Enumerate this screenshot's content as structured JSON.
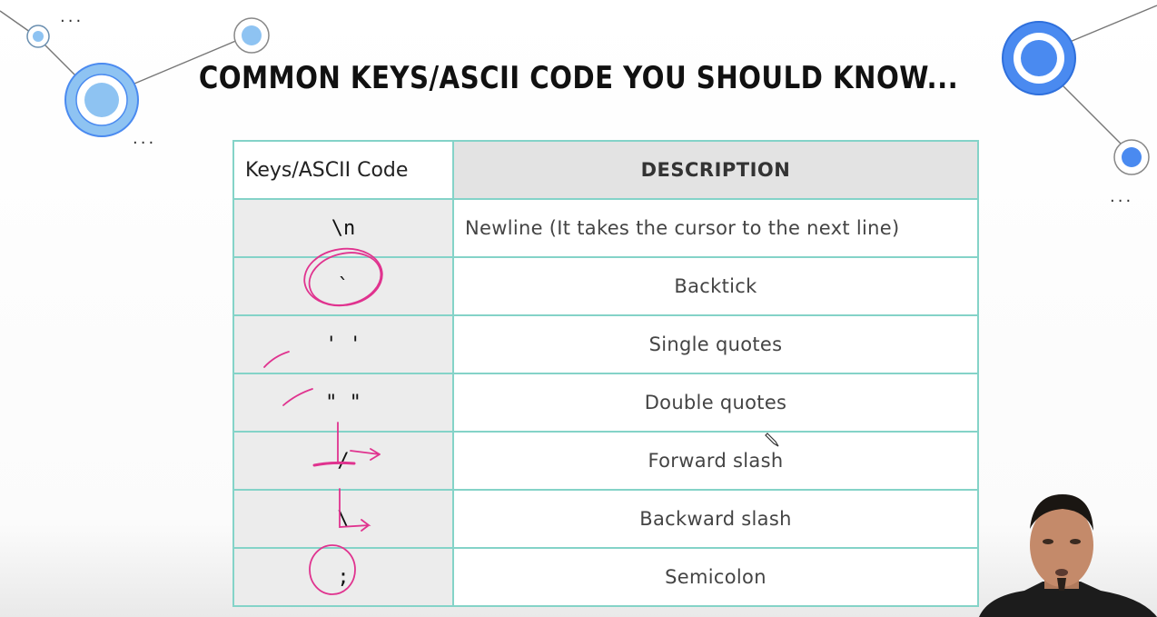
{
  "title": "COMMON KEYS/ASCII CODE YOU SHOULD KNOW...",
  "table": {
    "headers": [
      "Keys/ASCII Code",
      "DESCRIPTION"
    ],
    "rows": [
      {
        "key": "\\n",
        "description": "Newline (It takes the cursor to the next line)"
      },
      {
        "key": "`",
        "description": "Backtick"
      },
      {
        "key": "' '",
        "description": "Single quotes"
      },
      {
        "key": "\" \"",
        "description": "Double quotes"
      },
      {
        "key": "/",
        "description": "Forward slash"
      },
      {
        "key": "\\",
        "description": "Backward slash"
      },
      {
        "key": ";",
        "description": "Semicolon"
      }
    ]
  },
  "decor": {
    "ellipsis_marks": [
      "...",
      "...",
      "..."
    ],
    "accent_color": "#4a8af0",
    "light_accent_color": "#8ec3f2",
    "grid_color": "#84d3c8",
    "annotation_color": "#e0338f"
  }
}
